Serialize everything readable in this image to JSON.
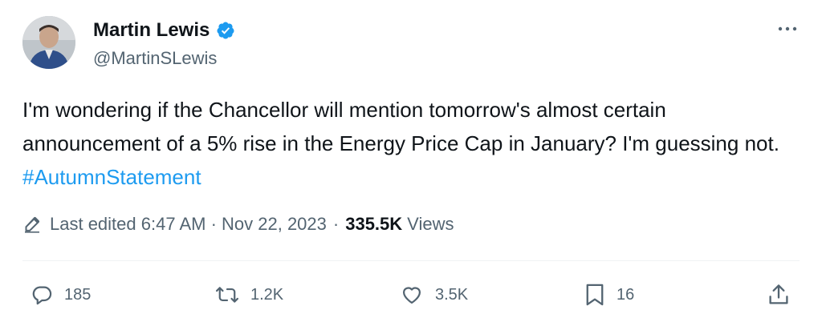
{
  "author": {
    "display_name": "Martin Lewis",
    "handle": "@MartinSLewis",
    "verified": true
  },
  "tweet": {
    "text_main": "I'm wondering if the Chancellor will mention tomorrow's almost certain announcement of a 5% rise in the Energy Price Cap in January? I'm guessing not. ",
    "hashtag": "#AutumnStatement"
  },
  "meta": {
    "edited_label": "Last edited 6:47 AM · Nov 22, 2023",
    "separator": "·",
    "views_count": "335.5K",
    "views_label": "Views"
  },
  "actions": {
    "replies": "185",
    "reposts": "1.2K",
    "likes": "3.5K",
    "bookmarks": "16"
  },
  "icons": {
    "verified": "verified-badge-icon",
    "more": "more-icon",
    "edit": "pencil-icon",
    "reply": "reply-icon",
    "repost": "repost-icon",
    "like": "heart-icon",
    "bookmark": "bookmark-icon",
    "share": "share-icon"
  },
  "colors": {
    "accent": "#1d9bf0",
    "secondary_text": "#536471",
    "primary_text": "#0f1419"
  }
}
